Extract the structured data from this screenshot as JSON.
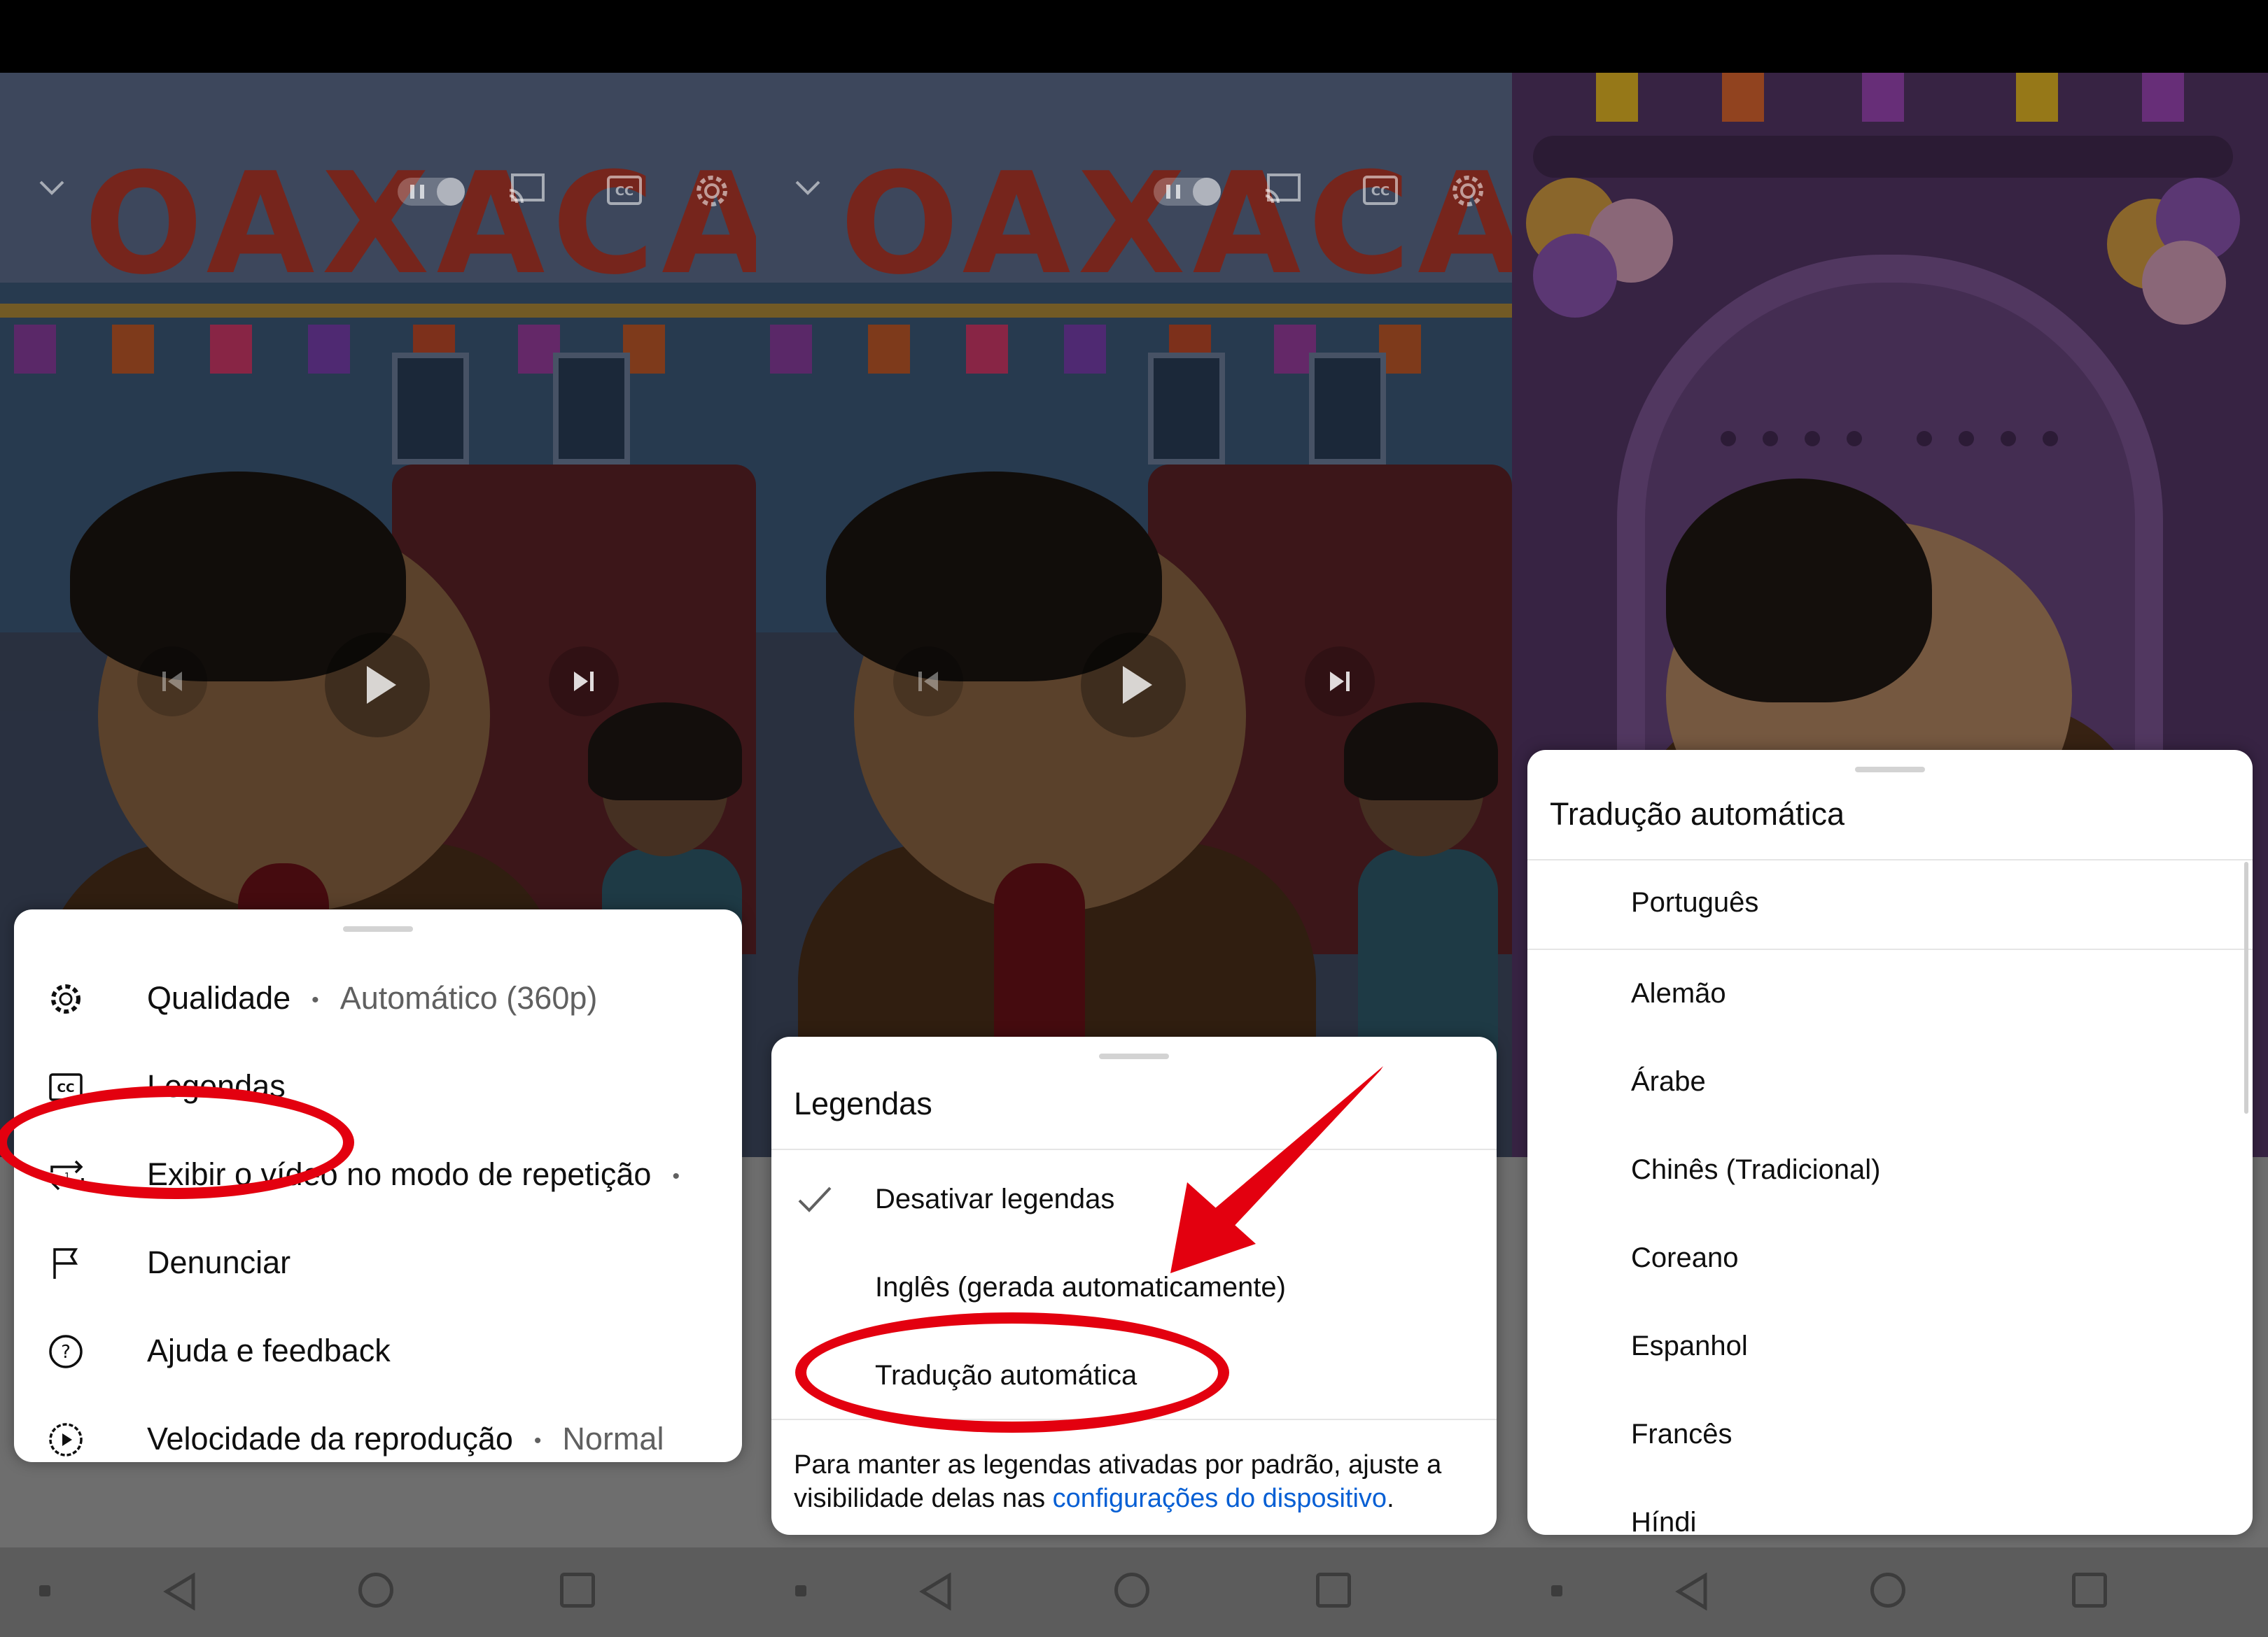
{
  "panel1": {
    "menu": {
      "quality_label": "Qualidade",
      "quality_value": "Automático (360p)",
      "captions_label": "Legendas",
      "loop_label": "Exibir o vídeo no modo de repetição",
      "report_label": "Denunciar",
      "help_label": "Ajuda e feedback",
      "speed_label": "Velocidade da reprodução",
      "speed_value": "Normal",
      "separator": "•"
    }
  },
  "panel2": {
    "sheet": {
      "title": "Legendas",
      "options": [
        "Desativar legendas",
        "Inglês (gerada automaticamente)",
        "Tradução automática"
      ],
      "footnote_text": "Para manter as legendas ativadas por padrão, ajuste a visibilidade delas nas ",
      "footnote_link": "configurações do dispositivo",
      "footnote_end": "."
    }
  },
  "panel3": {
    "sheet": {
      "title": "Tradução automática",
      "languages": [
        "Português",
        "Alemão",
        "Árabe",
        "Chinês (Tradicional)",
        "Coreano",
        "Espanhol",
        "Francês",
        "Híndi"
      ]
    }
  },
  "video": {
    "title_art": "OAXACA"
  },
  "colors": {
    "annotation_red": "#e3000f",
    "link_blue": "#065fd4",
    "sheet_bg": "#ffffff"
  },
  "icons": [
    "chevron-down-icon",
    "pause-toggle-icon",
    "cast-icon",
    "captions-icon",
    "gear-icon",
    "previous-icon",
    "play-icon",
    "next-icon",
    "loop-icon",
    "flag-icon",
    "help-icon",
    "speed-icon",
    "check-icon"
  ]
}
